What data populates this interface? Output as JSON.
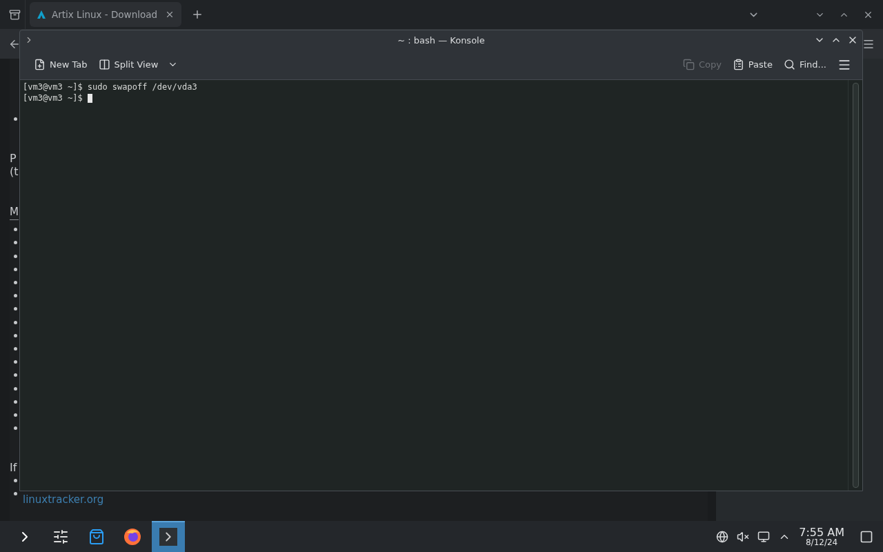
{
  "browser": {
    "tabs": [
      {
        "title": "Artix Linux - Download",
        "selected": true
      }
    ],
    "page": [
      {
        "kind": "bullet"
      },
      {
        "kind": "gap"
      },
      {
        "kind": "text",
        "text": "P"
      },
      {
        "kind": "text",
        "text": "(t"
      },
      {
        "kind": "gap"
      },
      {
        "kind": "link-heading",
        "text": "M"
      },
      {
        "kind": "bullet"
      },
      {
        "kind": "bullet"
      },
      {
        "kind": "bullet"
      },
      {
        "kind": "bullet"
      },
      {
        "kind": "bullet"
      },
      {
        "kind": "bullet"
      },
      {
        "kind": "bullet"
      },
      {
        "kind": "bullet"
      },
      {
        "kind": "bullet"
      },
      {
        "kind": "bullet"
      },
      {
        "kind": "bullet"
      },
      {
        "kind": "bullet"
      },
      {
        "kind": "bullet"
      },
      {
        "kind": "bullet"
      },
      {
        "kind": "bullet"
      },
      {
        "kind": "bullet"
      },
      {
        "kind": "gap"
      },
      {
        "kind": "text",
        "text": "If"
      },
      {
        "kind": "bullet"
      },
      {
        "kind": "bullet",
        "link": "linuxtracker.org"
      }
    ]
  },
  "konsole": {
    "title": "~ : bash — Konsole",
    "toolbar": [
      {
        "kind": "new-tab",
        "label": "New Tab",
        "disabled": false
      },
      {
        "kind": "split",
        "label": "Split View",
        "disabled": false
      },
      {
        "kind": "spacer"
      },
      {
        "kind": "copy",
        "label": "Copy",
        "disabled": true
      },
      {
        "kind": "paste",
        "label": "Paste",
        "disabled": false
      },
      {
        "kind": "find",
        "label": "Find...",
        "disabled": false
      },
      {
        "kind": "menu"
      }
    ],
    "lines": [
      {
        "prompt": "[vm3@vm3 ~]$",
        "command": "sudo swapoff /dev/vda3",
        "cursor": false
      },
      {
        "prompt": "[vm3@vm3 ~]$",
        "cursor": true
      }
    ]
  },
  "taskbar": {
    "apps": [
      {
        "kind": "launcher",
        "selected": false
      },
      {
        "kind": "settings",
        "selected": false
      },
      {
        "kind": "store",
        "selected": false
      },
      {
        "kind": "firefox",
        "selected": false
      },
      {
        "kind": "terminal",
        "selected": true
      }
    ],
    "clock": {
      "time": "7:55 AM",
      "date": "8/12/24"
    }
  }
}
